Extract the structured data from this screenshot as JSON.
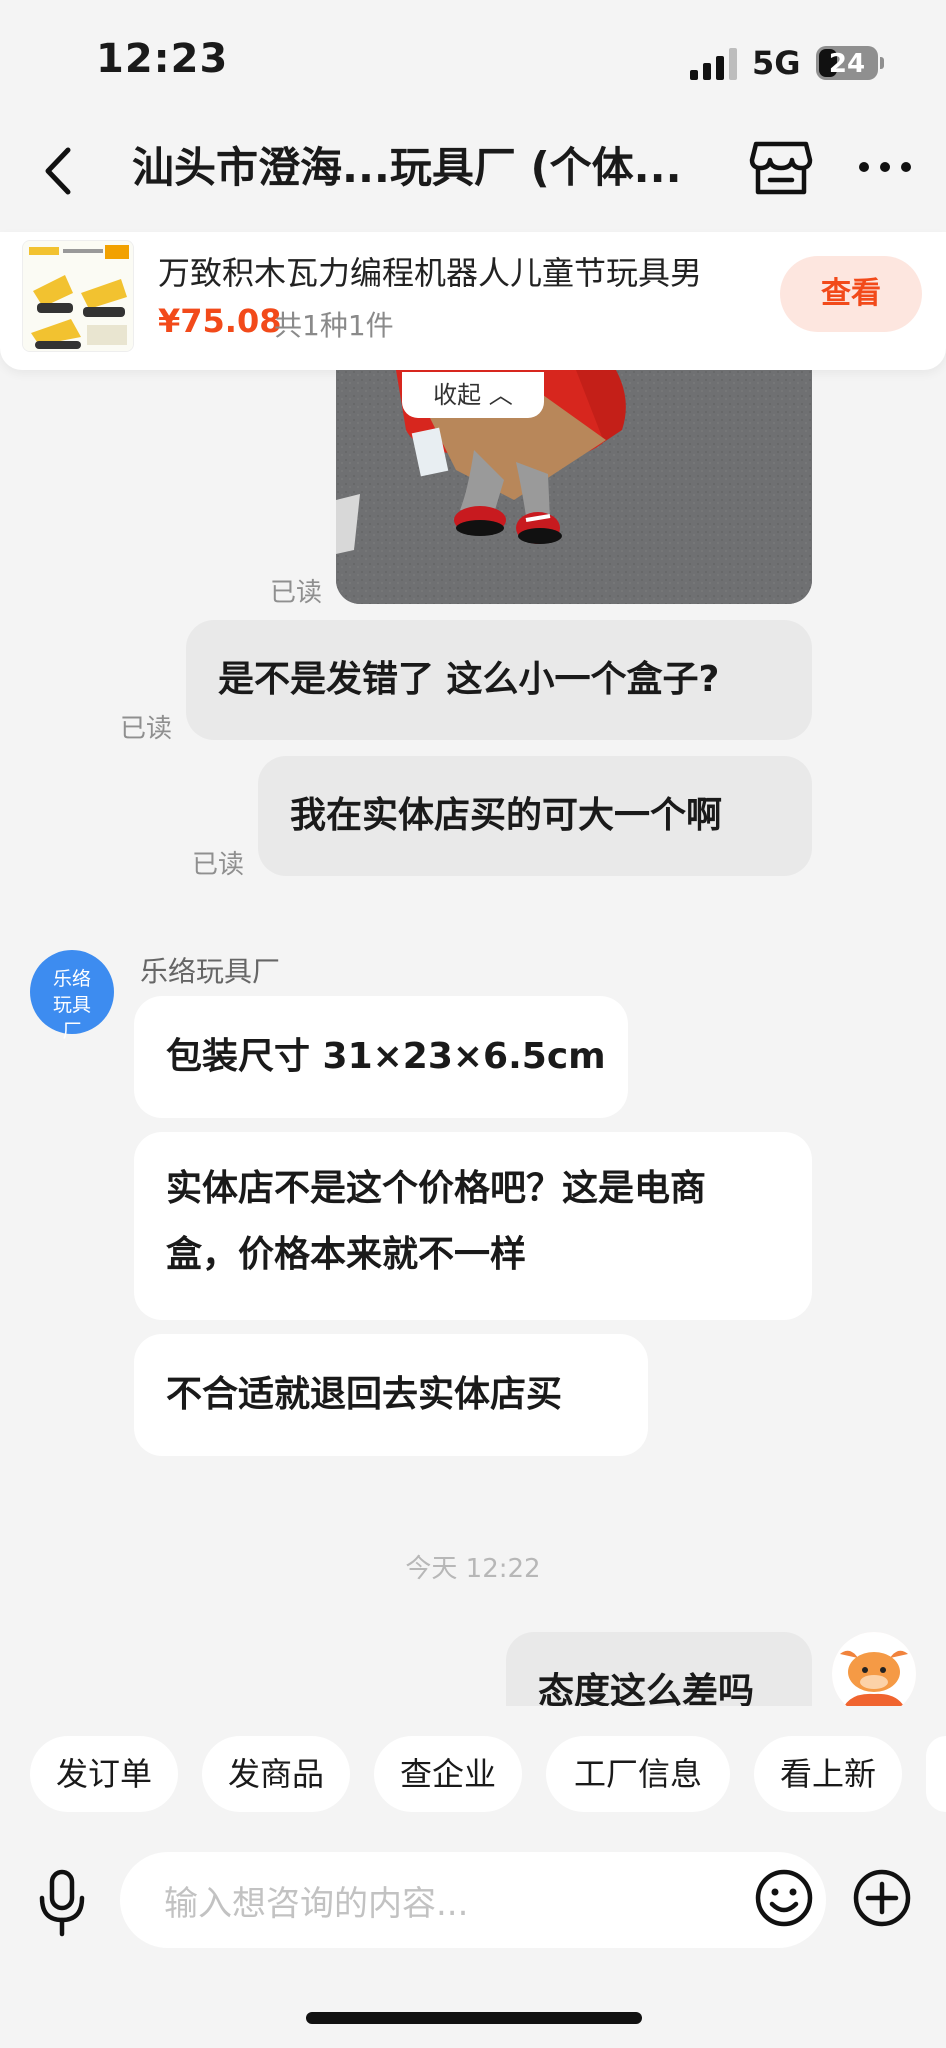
{
  "status_bar": {
    "time": "12:23",
    "network": "5G",
    "battery": "24"
  },
  "header": {
    "title": "汕头市澄海...玩具厂 (个体..."
  },
  "product": {
    "name": "万致积木瓦力编程机器人儿童节玩具男",
    "price": "¥75.08",
    "quantity": "共1种1件",
    "view_label": "查看"
  },
  "chat": {
    "collapse_label": "收起 ︿",
    "read_label": "已读",
    "my_messages": [
      "是不是发错了 这么小一个盒子?",
      "我在实体店买的可大一个啊"
    ],
    "shop_avatar_text": "乐络玩具厂",
    "sender_name": "乐络玩具厂",
    "shop_messages": [
      "包装尺寸 31×23×6.5cm",
      "实体店不是这个价格吧？这是电商",
      "盒，价格本来就不一样",
      "不合适就退回去实体店买"
    ],
    "timestamp": "今天 12:22",
    "latest_message": "态度这么差吗"
  },
  "quick_actions": [
    "发订单",
    "发商品",
    "查企业",
    "工厂信息",
    "看上新"
  ],
  "input": {
    "placeholder": "输入想咨询的内容..."
  },
  "colors": {
    "accent": "#f24a1a",
    "accent_bg": "#fde6df",
    "shop_avatar": "#3d8cf0",
    "background": "#f4f4f4"
  }
}
